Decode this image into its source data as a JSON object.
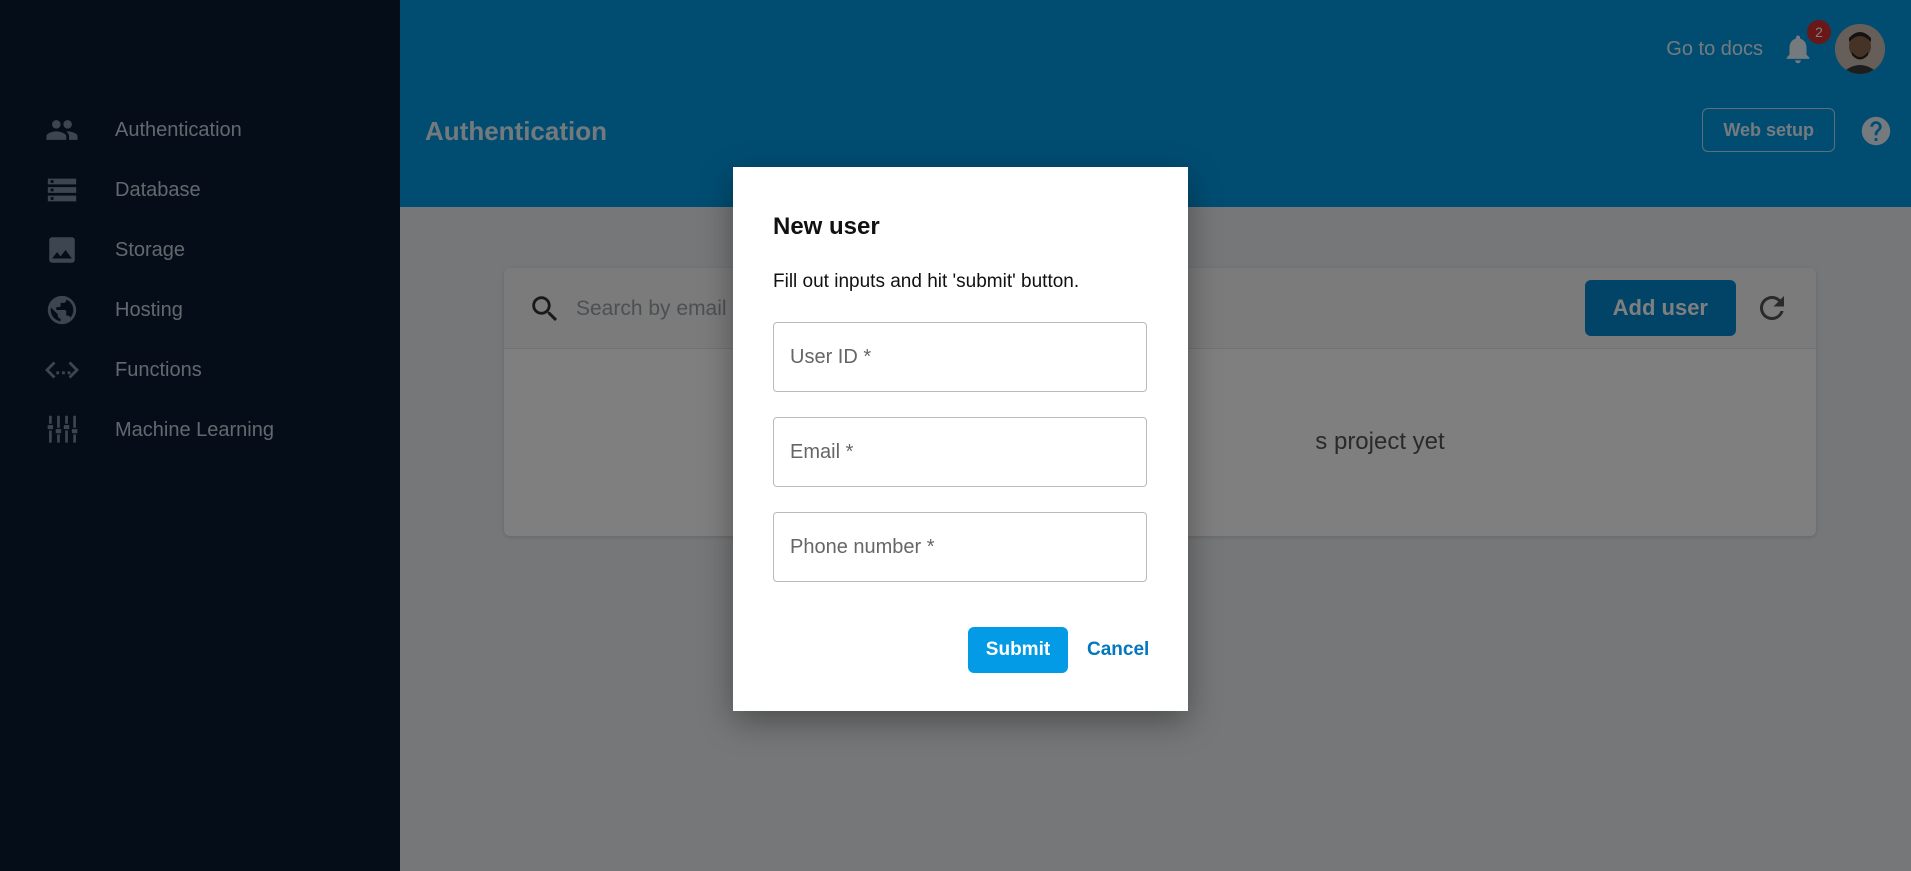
{
  "sidebar": {
    "items": [
      {
        "label": "Authentication",
        "icon": "people-icon"
      },
      {
        "label": "Database",
        "icon": "database-icon"
      },
      {
        "label": "Storage",
        "icon": "image-icon"
      },
      {
        "label": "Hosting",
        "icon": "globe-icon"
      },
      {
        "label": "Functions",
        "icon": "code-icon"
      },
      {
        "label": "Machine Learning",
        "icon": "sliders-icon"
      }
    ]
  },
  "header": {
    "docs_link": "Go to docs",
    "notification_count": "2",
    "title": "Authentication",
    "web_setup": "Web setup"
  },
  "users_card": {
    "search_placeholder": "Search by email",
    "add_user": "Add user",
    "empty_message": "s project yet"
  },
  "dialog": {
    "title": "New user",
    "description": "Fill out inputs and hit 'submit' button.",
    "user_id_placeholder": "User ID *",
    "email_placeholder": "Email *",
    "phone_placeholder": "Phone number *",
    "submit": "Submit",
    "cancel": "Cancel"
  },
  "colors": {
    "sidebar_bg": "#0b1b31",
    "header_bg": "#039be5",
    "primary_button": "#039be5",
    "link": "#0277bd",
    "badge": "#d32f2f"
  }
}
